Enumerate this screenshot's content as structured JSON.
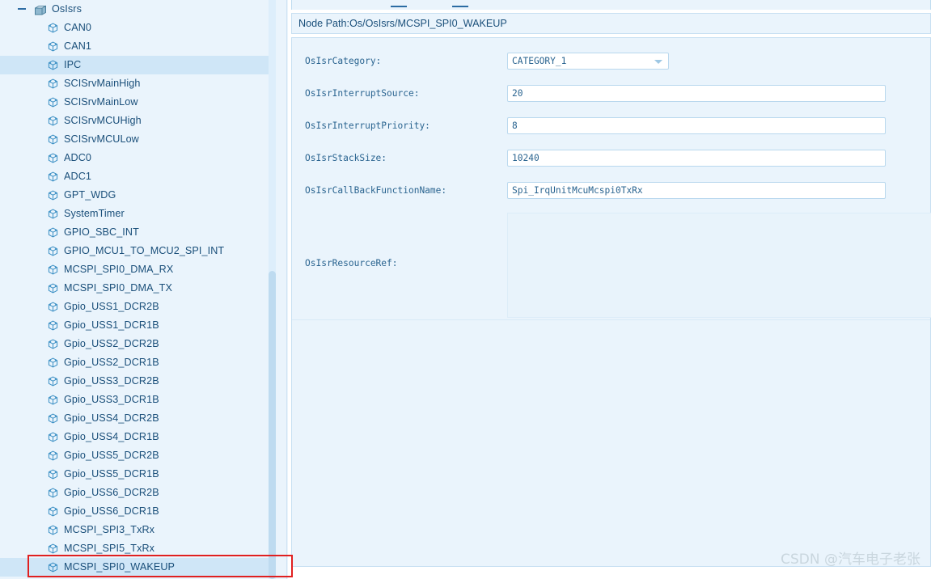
{
  "tree": {
    "root": {
      "label": "OsIsrs",
      "icon": "package-icon",
      "expanded": true,
      "toggle_icon": "minus-icon"
    },
    "item_icon": "cube-icon",
    "selected_items": [
      "IPC",
      "MCSPI_SPI0_WAKEUP"
    ],
    "items": [
      {
        "label": "CAN0"
      },
      {
        "label": "CAN1"
      },
      {
        "label": "IPC"
      },
      {
        "label": "SCISrvMainHigh"
      },
      {
        "label": "SCISrvMainLow"
      },
      {
        "label": "SCISrvMCUHigh"
      },
      {
        "label": "SCISrvMCULow"
      },
      {
        "label": "ADC0"
      },
      {
        "label": "ADC1"
      },
      {
        "label": "GPT_WDG"
      },
      {
        "label": "SystemTimer"
      },
      {
        "label": "GPIO_SBC_INT"
      },
      {
        "label": "GPIO_MCU1_TO_MCU2_SPI_INT"
      },
      {
        "label": "MCSPI_SPI0_DMA_RX"
      },
      {
        "label": "MCSPI_SPI0_DMA_TX"
      },
      {
        "label": "Gpio_USS1_DCR2B"
      },
      {
        "label": "Gpio_USS1_DCR1B"
      },
      {
        "label": "Gpio_USS2_DCR2B"
      },
      {
        "label": "Gpio_USS2_DCR1B"
      },
      {
        "label": "Gpio_USS3_DCR2B"
      },
      {
        "label": "Gpio_USS3_DCR1B"
      },
      {
        "label": "Gpio_USS4_DCR2B"
      },
      {
        "label": "Gpio_USS4_DCR1B"
      },
      {
        "label": "Gpio_USS5_DCR2B"
      },
      {
        "label": "Gpio_USS5_DCR1B"
      },
      {
        "label": "Gpio_USS6_DCR2B"
      },
      {
        "label": "Gpio_USS6_DCR1B"
      },
      {
        "label": "MCSPI_SPI3_TxRx"
      },
      {
        "label": "MCSPI_SPI5_TxRx"
      },
      {
        "label": "MCSPI_SPI0_WAKEUP"
      }
    ]
  },
  "node_path": {
    "text": "Node Path:Os/OsIsrs/MCSPI_SPI0_WAKEUP"
  },
  "form": {
    "fields": [
      {
        "label": "OsIsrCategory:",
        "value": "CATEGORY_1",
        "type": "combo"
      },
      {
        "label": "OsIsrInterruptSource:",
        "value": "20",
        "type": "text"
      },
      {
        "label": "OsIsrInterruptPriority:",
        "value": "8",
        "type": "text"
      },
      {
        "label": "OsIsrStackSize:",
        "value": "10240",
        "type": "text"
      },
      {
        "label": "OsIsrCallBackFunctionName:",
        "value": "Spi_IrqUnitMcuMcspi0TxRx",
        "type": "text"
      }
    ],
    "resource_ref": {
      "label": "OsIsrResourceRef:",
      "value": ""
    },
    "combo_arrow_icon": "chevron-down-icon"
  },
  "annotation": {
    "highlight_target": "MCSPI_SPI0_WAKEUP",
    "color": "#e02020"
  },
  "watermark": {
    "text": "CSDN @汽车电子老张"
  },
  "colors": {
    "panel_bg": "#eaf4fc",
    "selection": "#cfe6f7",
    "text": "#1a4f7a",
    "border": "#c8e0f2",
    "accent_red": "#e02020"
  }
}
